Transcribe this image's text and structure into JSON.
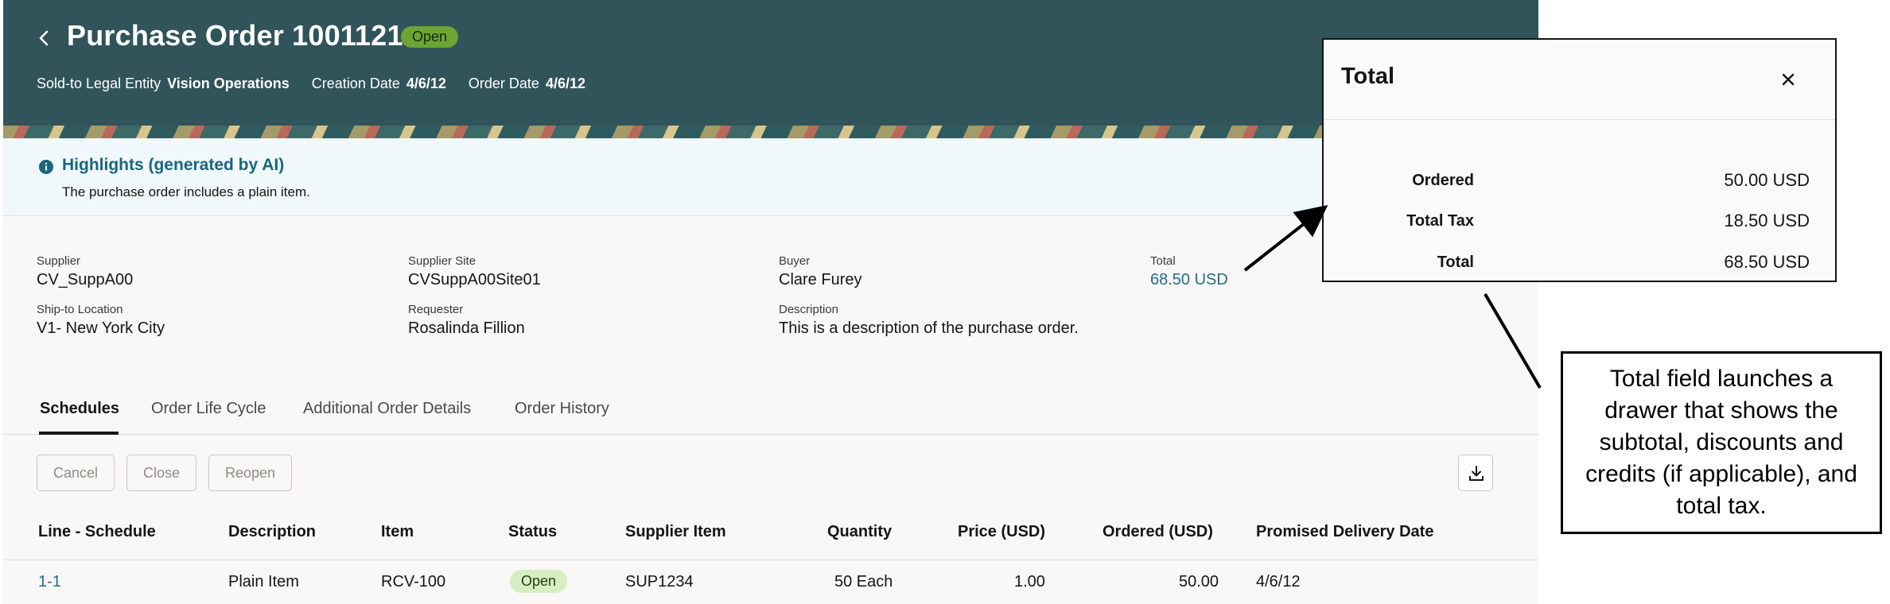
{
  "header": {
    "title": "Purchase Order 1001121",
    "status": "Open",
    "sold_to_label": "Sold-to Legal Entity",
    "sold_to_value": "Vision Operations",
    "creation_date_label": "Creation Date",
    "creation_date_value": "4/6/12",
    "order_date_label": "Order Date",
    "order_date_value": "4/6/12"
  },
  "highlights": {
    "title": "Highlights (generated by AI)",
    "text": "The purchase order includes a plain item."
  },
  "fields": {
    "supplier_label": "Supplier",
    "supplier_value": "CV_SuppA00",
    "supplier_site_label": "Supplier Site",
    "supplier_site_value": "CVSuppA00Site01",
    "buyer_label": "Buyer",
    "buyer_value": "Clare Furey",
    "total_label": "Total",
    "total_value": "68.50 USD",
    "ship_to_label": "Ship-to Location",
    "ship_to_value": "V1- New York City",
    "requester_label": "Requester",
    "requester_value": "Rosalinda Fillion",
    "description_label": "Description",
    "description_value": "This is a description of the purchase order."
  },
  "tabs": [
    "Schedules",
    "Order Life Cycle",
    "Additional Order Details",
    "Order History"
  ],
  "toolbar": {
    "cancel_label": "Cancel",
    "close_label": "Close",
    "reopen_label": "Reopen"
  },
  "table": {
    "columns": [
      "Line - Schedule",
      "Description",
      "Item",
      "Status",
      "Supplier Item",
      "Quantity",
      "Price (USD)",
      "Ordered (USD)",
      "Promised Delivery Date"
    ],
    "rows": [
      [
        "1-1",
        "Plain Item",
        "RCV-100",
        "Open",
        "SUP1234",
        "50 Each",
        "1.00",
        "50.00",
        "4/6/12"
      ]
    ]
  },
  "drawer": {
    "title": "Total",
    "rows": [
      {
        "label": "Ordered",
        "value": "50.00 USD"
      },
      {
        "label": "Total Tax",
        "value": "18.50 USD"
      },
      {
        "label": "Total",
        "value": "68.50 USD"
      }
    ]
  },
  "callout": {
    "text": "Total field launches a drawer that shows the subtotal, discounts and credits (if applicable), and total tax."
  },
  "colors": {
    "header_bg": "#30545a",
    "link": "#1f6e8c",
    "status_green": "#6da532",
    "status_pill_light": "#d6eec2",
    "highlight_bg": "#f0f8fb"
  },
  "icons": [
    "chevron-left-icon",
    "info-icon",
    "download-icon",
    "close-icon"
  ]
}
